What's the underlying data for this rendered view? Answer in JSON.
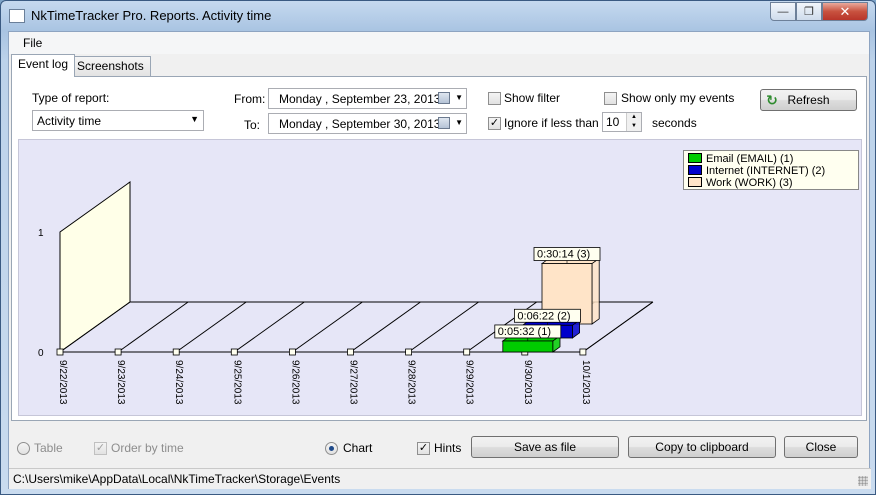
{
  "window": {
    "title": "NkTimeTracker Pro. Reports. Activity time"
  },
  "menu": {
    "file": "File"
  },
  "tabs": [
    {
      "label": "Event log",
      "active": true
    },
    {
      "label": "Screenshots",
      "active": false
    }
  ],
  "filters": {
    "type_label": "Type of report:",
    "type_value": "Activity time",
    "from_label": "From:",
    "from_weekday": "Monday",
    "from_date": ", September 23, 2013",
    "to_label": "To:",
    "to_weekday": "Monday",
    "to_date": ", September 30, 2013",
    "show_filter_label": "Show filter",
    "show_filter_checked": false,
    "ignore_label": "Ignore if less than",
    "ignore_checked": true,
    "ignore_value": "10",
    "seconds_label": "seconds",
    "show_only_my_label": "Show only my events",
    "show_only_my_checked": false,
    "refresh_label": "Refresh"
  },
  "chart_data": {
    "type": "bar",
    "categories": [
      "9/22/2013",
      "9/23/2013",
      "9/24/2013",
      "9/25/2013",
      "9/26/2013",
      "9/27/2013",
      "9/28/2013",
      "9/29/2013",
      "9/30/2013",
      "10/1/2013"
    ],
    "y_ticks": [
      "0",
      "1"
    ],
    "series": [
      {
        "name": "Email  (EMAIL) (1)",
        "color": "#00cc00",
        "values": [
          0,
          0,
          0,
          0,
          0,
          0,
          0,
          0,
          0.092,
          0
        ],
        "labels": [
          "",
          "",
          "",
          "",
          "",
          "",
          "",
          "",
          "0:05:32 (1)",
          ""
        ]
      },
      {
        "name": "Internet  (INTERNET) (2)",
        "color": "#0000cc",
        "values": [
          0,
          0,
          0,
          0,
          0,
          0,
          0,
          0,
          0.106,
          0
        ],
        "labels": [
          "",
          "",
          "",
          "",
          "",
          "",
          "",
          "",
          "0:06:22 (2)",
          ""
        ]
      },
      {
        "name": "Work  (WORK) (3)",
        "color": "#ffe4c8",
        "values": [
          0,
          0,
          0,
          0,
          0,
          0,
          0,
          0,
          0.504,
          0
        ],
        "labels": [
          "",
          "",
          "",
          "",
          "",
          "",
          "",
          "",
          "0:30:14 (3)",
          ""
        ]
      }
    ],
    "ylim": [
      0,
      1
    ],
    "legend_position": "top-right"
  },
  "bottom": {
    "table_label": "Table",
    "table_selected": false,
    "order_label": "Order by time",
    "order_checked": true,
    "chart_label": "Chart",
    "chart_selected": true,
    "hints_label": "Hints",
    "hints_checked": true,
    "save_label": "Save as file",
    "copy_label": "Copy to clipboard",
    "close_label": "Close"
  },
  "status": {
    "path": "C:\\Users\\mike\\AppData\\Local\\NkTimeTracker\\Storage\\Events"
  }
}
